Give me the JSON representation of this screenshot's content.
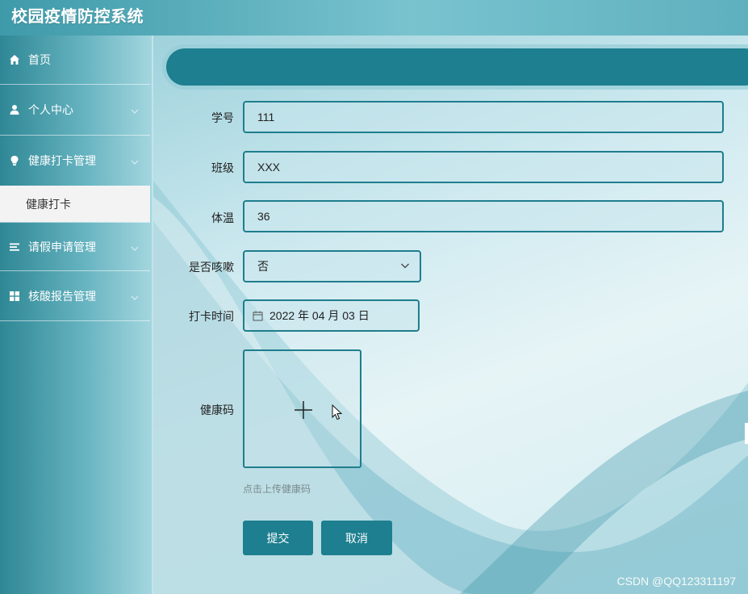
{
  "app": {
    "title": "校园疫情防控系统"
  },
  "sidebar": {
    "items": [
      {
        "label": "首页",
        "icon": "home-icon",
        "expandable": false
      },
      {
        "label": "个人中心",
        "icon": "user-icon",
        "expandable": true
      },
      {
        "label": "健康打卡管理",
        "icon": "bulb-icon",
        "expandable": true,
        "expanded": true,
        "children": [
          {
            "label": "健康打卡",
            "active": true
          }
        ]
      },
      {
        "label": "请假申请管理",
        "icon": "list-icon",
        "expandable": true
      },
      {
        "label": "核酸报告管理",
        "icon": "grid-icon",
        "expandable": true
      }
    ]
  },
  "form": {
    "student_id": {
      "label": "学号",
      "value": "111"
    },
    "class": {
      "label": "班级",
      "value": "XXX"
    },
    "temperature": {
      "label": "体温",
      "value": "36"
    },
    "cough": {
      "label": "是否咳嗽",
      "value": "否"
    },
    "checkin_time": {
      "label": "打卡时间",
      "value": "2022 年 04 月 03 日"
    },
    "health_code": {
      "label": "健康码",
      "hint": "点击上传健康码"
    },
    "submit_label": "提交",
    "cancel_label": "取消"
  },
  "watermark": "CSDN @QQ123311197",
  "colors": {
    "accent": "#1d7f8f",
    "header_start": "#3e9aa9",
    "active_item_bg": "#f3f3f3"
  }
}
